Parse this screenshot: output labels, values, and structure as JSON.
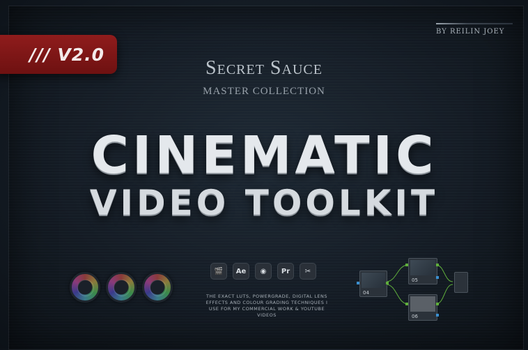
{
  "author": "BY REILIN JOEY",
  "version": "/// V2.0",
  "brand": "Secret Sauce",
  "collection": "MASTER COLLECTION",
  "headline": "CINEMATIC",
  "subheadline": "VIDEO TOOLKIT",
  "apps": [
    {
      "name": "final-cut-pro-icon",
      "label": "🎬"
    },
    {
      "name": "after-effects-icon",
      "label": "Ae"
    },
    {
      "name": "davinci-resolve-icon",
      "label": "◉"
    },
    {
      "name": "premiere-pro-icon",
      "label": "Pr"
    },
    {
      "name": "capcut-icon",
      "label": "✂"
    }
  ],
  "description": "THE EXACT LUTS, POWERGRADE, DIGITAL LENS EFFECTS AND COLOUR GRADING TECHNIQUES I USE FOR MY COMMERCIAL WORK & YOUTUBE VIDEOS",
  "nodes": {
    "n04": "04",
    "n05": "05",
    "n06": "06"
  },
  "colors": {
    "accent_red": "#8f1c1c",
    "port_green": "#5fae3c",
    "port_blue": "#3a8fd0"
  }
}
